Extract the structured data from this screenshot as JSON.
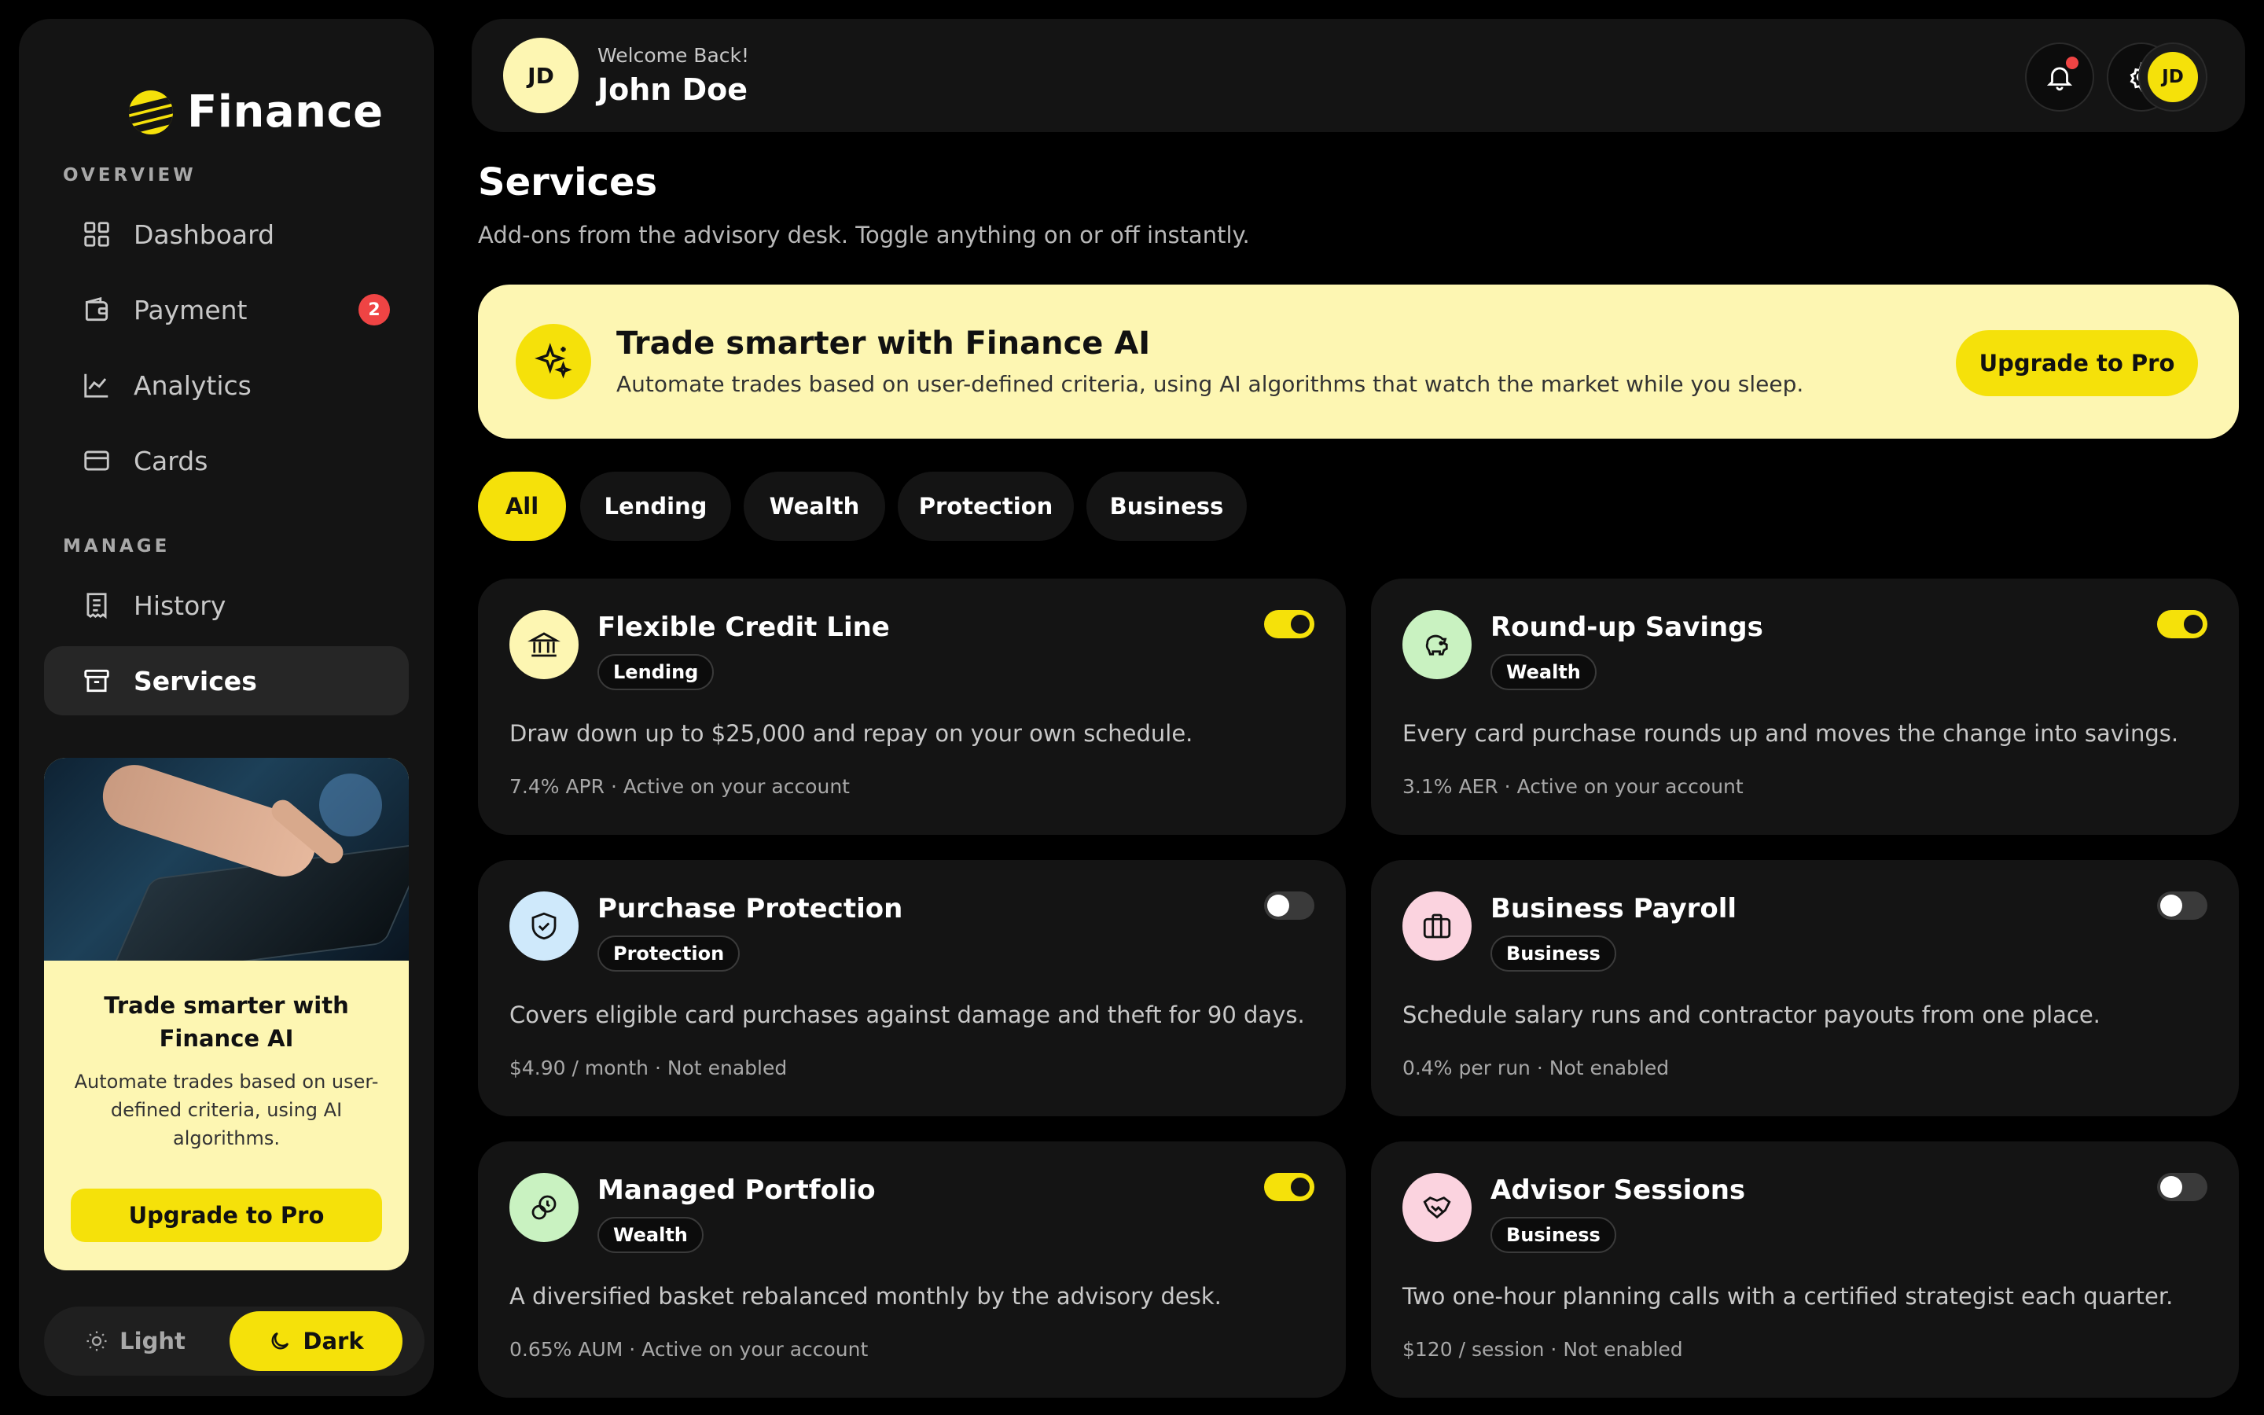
{
  "sidebar": {
    "brand": "Finance",
    "overview_label": "OVERVIEW",
    "manage_label": "MANAGE",
    "items": [
      {
        "label": "Dashboard"
      },
      {
        "label": "Payment",
        "badge": "2"
      },
      {
        "label": "Analytics"
      },
      {
        "label": "Cards"
      },
      {
        "label": "History"
      },
      {
        "label": "Services"
      }
    ],
    "promo": {
      "title": "Trade smarter with Finance AI",
      "text": "Automate trades based on user-defined criteria, using AI algorithms.",
      "button": "Upgrade to Pro"
    },
    "theme": {
      "light": "Light",
      "dark": "Dark",
      "selected": "Dark"
    }
  },
  "header": {
    "avatar_initials": "JD",
    "welcome": "Welcome Back!",
    "name": "John Doe"
  },
  "page": {
    "title": "Services",
    "subtitle": "Add-ons from the advisory desk. Toggle anything on or off instantly."
  },
  "banner": {
    "title": "Trade smarter with Finance AI",
    "text": "Automate trades based on user-defined criteria, using AI algorithms that watch the market while you sleep.",
    "button": "Upgrade to Pro"
  },
  "filters": [
    "All",
    "Lending",
    "Wealth",
    "Protection",
    "Business"
  ],
  "services": [
    {
      "title": "Flexible Credit Line",
      "tag": "Lending",
      "desc": "Draw down up to $25,000 and repay on your own schedule.",
      "meta": "7.4% APR · Active on your account",
      "enabled": true,
      "icon": "bank-icon",
      "icon_bg": "#fdf6b2"
    },
    {
      "title": "Round-up Savings",
      "tag": "Wealth",
      "desc": "Every card purchase rounds up and moves the change into savings.",
      "meta": "3.1% AER · Active on your account",
      "enabled": true,
      "icon": "piggy-bank-icon",
      "icon_bg": "#c9f2c1"
    },
    {
      "title": "Purchase Protection",
      "tag": "Protection",
      "desc": "Covers eligible card purchases against damage and theft for 90 days.",
      "meta": "$4.90 / month · Not enabled",
      "enabled": false,
      "icon": "shield-check-icon",
      "icon_bg": "#cfe9fb"
    },
    {
      "title": "Business Payroll",
      "tag": "Business",
      "desc": "Schedule salary runs and contractor payouts from one place.",
      "meta": "0.4% per run · Not enabled",
      "enabled": false,
      "icon": "briefcase-icon",
      "icon_bg": "#fbd3df"
    },
    {
      "title": "Managed Portfolio",
      "tag": "Wealth",
      "desc": "A diversified basket rebalanced monthly by the advisory desk.",
      "meta": "0.65% AUM · Active on your account",
      "enabled": true,
      "icon": "coins-icon",
      "icon_bg": "#c9f2c1"
    },
    {
      "title": "Advisor Sessions",
      "tag": "Business",
      "desc": "Two one-hour planning calls with a certified strategist each quarter.",
      "meta": "$120 / session · Not enabled",
      "enabled": false,
      "icon": "handshake-icon",
      "icon_bg": "#fbd3df"
    }
  ],
  "colors": {
    "accent": "#f5e10a",
    "accent_soft": "#fdf6b2",
    "badge": "#ef4444",
    "panel": "#141414"
  }
}
